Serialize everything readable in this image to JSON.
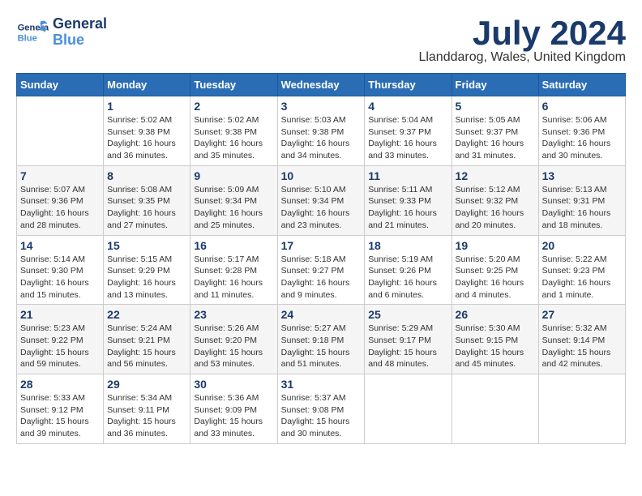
{
  "logo": {
    "line1": "General",
    "line2": "Blue"
  },
  "title": {
    "month": "July 2024",
    "location": "Llanddarog, Wales, United Kingdom"
  },
  "weekdays": [
    "Sunday",
    "Monday",
    "Tuesday",
    "Wednesday",
    "Thursday",
    "Friday",
    "Saturday"
  ],
  "weeks": [
    [
      {
        "day": "",
        "info": ""
      },
      {
        "day": "1",
        "info": "Sunrise: 5:02 AM\nSunset: 9:38 PM\nDaylight: 16 hours\nand 36 minutes."
      },
      {
        "day": "2",
        "info": "Sunrise: 5:02 AM\nSunset: 9:38 PM\nDaylight: 16 hours\nand 35 minutes."
      },
      {
        "day": "3",
        "info": "Sunrise: 5:03 AM\nSunset: 9:38 PM\nDaylight: 16 hours\nand 34 minutes."
      },
      {
        "day": "4",
        "info": "Sunrise: 5:04 AM\nSunset: 9:37 PM\nDaylight: 16 hours\nand 33 minutes."
      },
      {
        "day": "5",
        "info": "Sunrise: 5:05 AM\nSunset: 9:37 PM\nDaylight: 16 hours\nand 31 minutes."
      },
      {
        "day": "6",
        "info": "Sunrise: 5:06 AM\nSunset: 9:36 PM\nDaylight: 16 hours\nand 30 minutes."
      }
    ],
    [
      {
        "day": "7",
        "info": "Sunrise: 5:07 AM\nSunset: 9:36 PM\nDaylight: 16 hours\nand 28 minutes."
      },
      {
        "day": "8",
        "info": "Sunrise: 5:08 AM\nSunset: 9:35 PM\nDaylight: 16 hours\nand 27 minutes."
      },
      {
        "day": "9",
        "info": "Sunrise: 5:09 AM\nSunset: 9:34 PM\nDaylight: 16 hours\nand 25 minutes."
      },
      {
        "day": "10",
        "info": "Sunrise: 5:10 AM\nSunset: 9:34 PM\nDaylight: 16 hours\nand 23 minutes."
      },
      {
        "day": "11",
        "info": "Sunrise: 5:11 AM\nSunset: 9:33 PM\nDaylight: 16 hours\nand 21 minutes."
      },
      {
        "day": "12",
        "info": "Sunrise: 5:12 AM\nSunset: 9:32 PM\nDaylight: 16 hours\nand 20 minutes."
      },
      {
        "day": "13",
        "info": "Sunrise: 5:13 AM\nSunset: 9:31 PM\nDaylight: 16 hours\nand 18 minutes."
      }
    ],
    [
      {
        "day": "14",
        "info": "Sunrise: 5:14 AM\nSunset: 9:30 PM\nDaylight: 16 hours\nand 15 minutes."
      },
      {
        "day": "15",
        "info": "Sunrise: 5:15 AM\nSunset: 9:29 PM\nDaylight: 16 hours\nand 13 minutes."
      },
      {
        "day": "16",
        "info": "Sunrise: 5:17 AM\nSunset: 9:28 PM\nDaylight: 16 hours\nand 11 minutes."
      },
      {
        "day": "17",
        "info": "Sunrise: 5:18 AM\nSunset: 9:27 PM\nDaylight: 16 hours\nand 9 minutes."
      },
      {
        "day": "18",
        "info": "Sunrise: 5:19 AM\nSunset: 9:26 PM\nDaylight: 16 hours\nand 6 minutes."
      },
      {
        "day": "19",
        "info": "Sunrise: 5:20 AM\nSunset: 9:25 PM\nDaylight: 16 hours\nand 4 minutes."
      },
      {
        "day": "20",
        "info": "Sunrise: 5:22 AM\nSunset: 9:23 PM\nDaylight: 16 hours\nand 1 minute."
      }
    ],
    [
      {
        "day": "21",
        "info": "Sunrise: 5:23 AM\nSunset: 9:22 PM\nDaylight: 15 hours\nand 59 minutes."
      },
      {
        "day": "22",
        "info": "Sunrise: 5:24 AM\nSunset: 9:21 PM\nDaylight: 15 hours\nand 56 minutes."
      },
      {
        "day": "23",
        "info": "Sunrise: 5:26 AM\nSunset: 9:20 PM\nDaylight: 15 hours\nand 53 minutes."
      },
      {
        "day": "24",
        "info": "Sunrise: 5:27 AM\nSunset: 9:18 PM\nDaylight: 15 hours\nand 51 minutes."
      },
      {
        "day": "25",
        "info": "Sunrise: 5:29 AM\nSunset: 9:17 PM\nDaylight: 15 hours\nand 48 minutes."
      },
      {
        "day": "26",
        "info": "Sunrise: 5:30 AM\nSunset: 9:15 PM\nDaylight: 15 hours\nand 45 minutes."
      },
      {
        "day": "27",
        "info": "Sunrise: 5:32 AM\nSunset: 9:14 PM\nDaylight: 15 hours\nand 42 minutes."
      }
    ],
    [
      {
        "day": "28",
        "info": "Sunrise: 5:33 AM\nSunset: 9:12 PM\nDaylight: 15 hours\nand 39 minutes."
      },
      {
        "day": "29",
        "info": "Sunrise: 5:34 AM\nSunset: 9:11 PM\nDaylight: 15 hours\nand 36 minutes."
      },
      {
        "day": "30",
        "info": "Sunrise: 5:36 AM\nSunset: 9:09 PM\nDaylight: 15 hours\nand 33 minutes."
      },
      {
        "day": "31",
        "info": "Sunrise: 5:37 AM\nSunset: 9:08 PM\nDaylight: 15 hours\nand 30 minutes."
      },
      {
        "day": "",
        "info": ""
      },
      {
        "day": "",
        "info": ""
      },
      {
        "day": "",
        "info": ""
      }
    ]
  ]
}
